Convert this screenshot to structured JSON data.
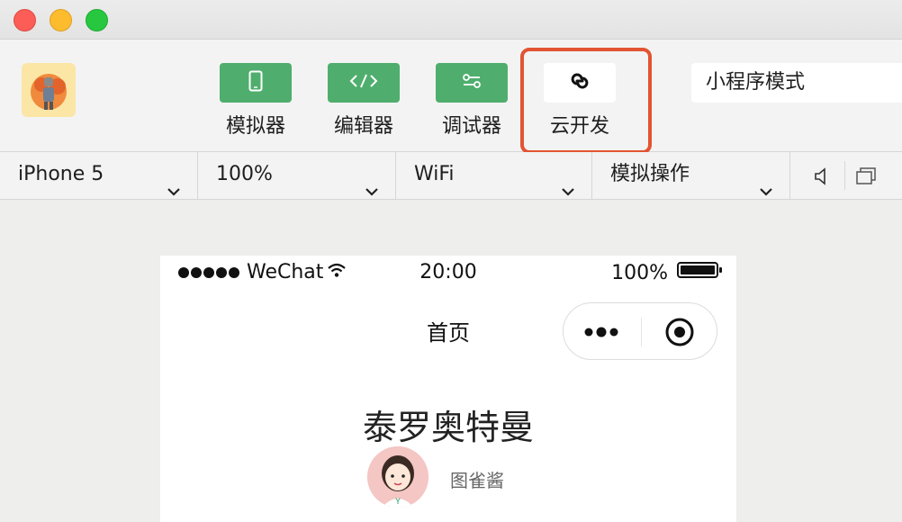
{
  "window": {
    "controls": [
      "close",
      "minimize",
      "maximize"
    ]
  },
  "toolbar": {
    "avatar_icon": "app-avatar",
    "tools": [
      {
        "label": "模拟器",
        "icon": "phone-icon"
      },
      {
        "label": "编辑器",
        "icon": "code-icon"
      },
      {
        "label": "调试器",
        "icon": "sliders-icon"
      },
      {
        "label": "云开发",
        "icon": "cloud-link-icon"
      }
    ],
    "mode_select": "小程序模式"
  },
  "device_bar": {
    "device": "iPhone 5",
    "zoom": "100%",
    "network": "WiFi",
    "action": "模拟操作"
  },
  "phone": {
    "status": {
      "carrier": "WeChat",
      "time": "20:00",
      "battery": "100%"
    },
    "nav_title": "首页",
    "article_title": "泰罗奥特曼",
    "author_name": "图雀酱"
  },
  "colors": {
    "green": "#4fae6d",
    "highlight": "#e25433"
  }
}
